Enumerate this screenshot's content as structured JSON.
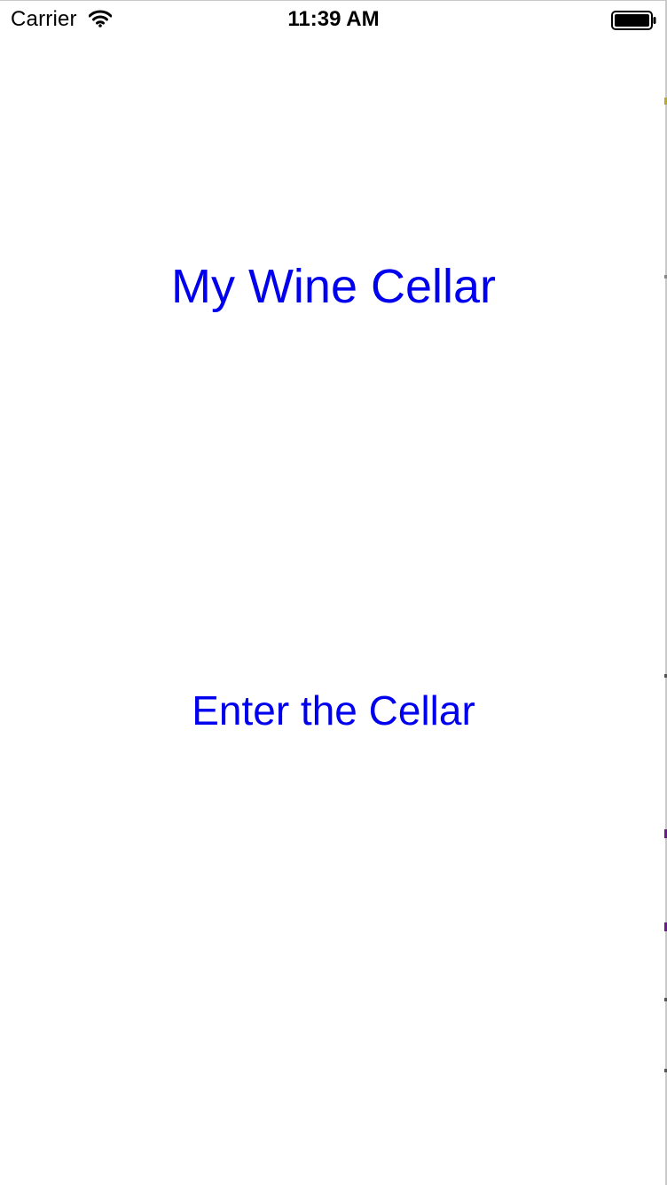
{
  "status_bar": {
    "carrier": "Carrier",
    "time": "11:39 AM",
    "wifi_icon": "wifi-icon",
    "battery_icon": "battery-full-icon"
  },
  "main": {
    "title": "My Wine Cellar",
    "enter_button_label": "Enter the Cellar"
  },
  "colors": {
    "text_accent": "#0000ee",
    "background": "#ffffff",
    "status_text": "#000000"
  }
}
